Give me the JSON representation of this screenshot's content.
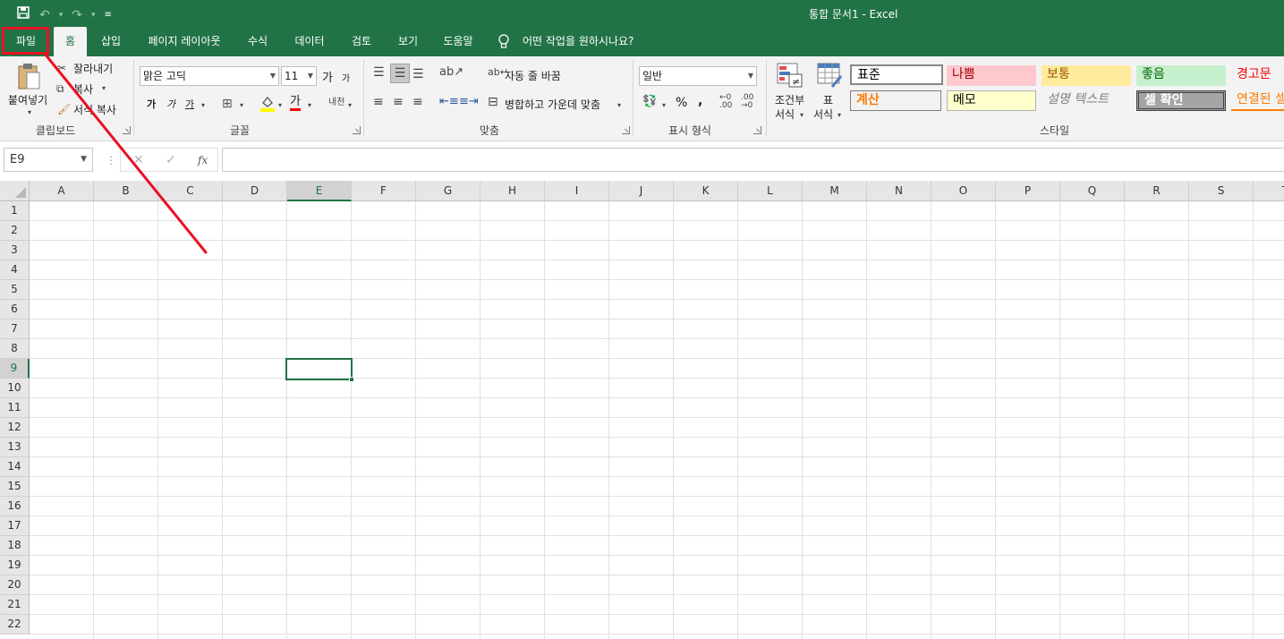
{
  "titlebar": {
    "title": "통합 문서1  -  Excel",
    "qat": {
      "save_icon": "save-icon",
      "undo_icon": "undo-icon",
      "redo_icon": "redo-icon",
      "customize_icon": "customize-qat-icon"
    }
  },
  "tabs": [
    {
      "label": "파일",
      "active": false
    },
    {
      "label": "홈",
      "active": true
    },
    {
      "label": "삽입",
      "active": false
    },
    {
      "label": "페이지 레이아웃",
      "active": false
    },
    {
      "label": "수식",
      "active": false
    },
    {
      "label": "데이터",
      "active": false
    },
    {
      "label": "검토",
      "active": false
    },
    {
      "label": "보기",
      "active": false
    },
    {
      "label": "도움말",
      "active": false
    }
  ],
  "tell_me": {
    "text": "어떤 작업을 원하시나요?",
    "icon": "lightbulb-icon"
  },
  "ribbon": {
    "clipboard": {
      "label": "클립보드",
      "paste": "붙여넣기",
      "cut": "잘라내기",
      "copy": "복사",
      "format_painter": "서식 복사"
    },
    "font": {
      "label": "글꼴",
      "font_name": "맑은 고딕",
      "font_size": "11",
      "grow": "가",
      "shrink": "가",
      "bold": "가",
      "italic": "가",
      "underline": "가",
      "font_color": "가",
      "phonetic": "내천"
    },
    "alignment": {
      "label": "맞춤",
      "wrap_text": "자동 줄 바꿈",
      "merge_center": "병합하고 가운데 맞춤"
    },
    "number": {
      "label": "표시 형식",
      "format": "일반",
      "percent": "%",
      "comma": ","
    },
    "styles": {
      "label": "스타일",
      "conditional_top": "조건부",
      "conditional_bottom": "서식",
      "table_top": "표",
      "table_bottom": "서식",
      "cells": [
        {
          "label": "표준",
          "bg": "#ffffff",
          "fg": "#000000"
        },
        {
          "label": "나쁨",
          "bg": "#ffc7ce",
          "fg": "#9c0006"
        },
        {
          "label": "보통",
          "bg": "#ffeb9c",
          "fg": "#9c5700"
        },
        {
          "label": "좋음",
          "bg": "#c6efce",
          "fg": "#006100"
        },
        {
          "label": "경고문",
          "bg": "#f3f3f3",
          "fg": "#ff0000"
        },
        {
          "label": "계산",
          "bg": "#f2f2f2",
          "fg": "#fa7d00"
        },
        {
          "label": "메모",
          "bg": "#ffffcc",
          "fg": "#000000"
        },
        {
          "label": "설명 텍스트",
          "bg": "#f3f3f3",
          "fg": "#7f7f7f"
        },
        {
          "label": "셀 확인",
          "bg": "#a5a5a5",
          "fg": "#ffffff"
        },
        {
          "label": "연결된 셀",
          "bg": "#f3f3f3",
          "fg": "#fa7d00"
        }
      ]
    }
  },
  "formula_bar": {
    "name_box": "E9",
    "cancel": "✕",
    "enter": "✓",
    "fx": "fx",
    "value": ""
  },
  "grid": {
    "columns": [
      "A",
      "B",
      "C",
      "D",
      "E",
      "F",
      "G",
      "H",
      "I",
      "J",
      "K",
      "L",
      "M",
      "N",
      "O",
      "P",
      "Q",
      "R",
      "S",
      "T"
    ],
    "rows": [
      "1",
      "2",
      "3",
      "4",
      "5",
      "6",
      "7",
      "8",
      "9",
      "10",
      "11",
      "12",
      "13",
      "14",
      "15",
      "16",
      "17",
      "18",
      "19",
      "20",
      "21",
      "22"
    ],
    "selected_col": "E",
    "selected_row": "9"
  },
  "colors": {
    "excel_green": "#217346",
    "annotation_red": "#e81123"
  }
}
